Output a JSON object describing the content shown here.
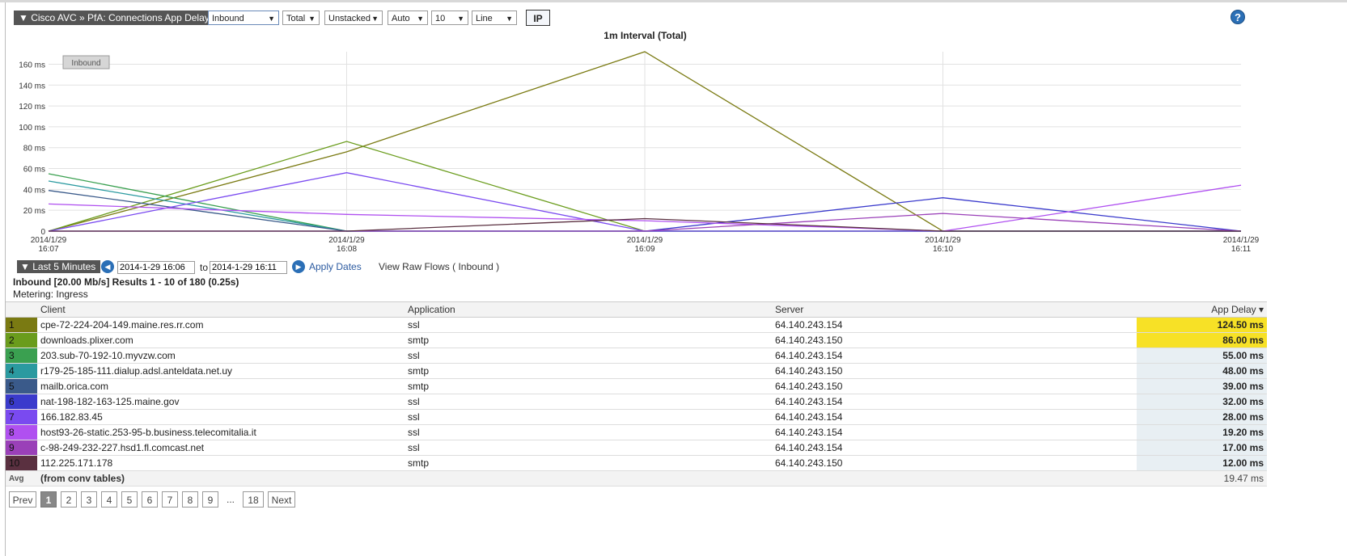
{
  "header": {
    "title": "▼ Cisco AVC » PfA: Connections App Delay",
    "selects": [
      "Inbound",
      "Total",
      "Unstacked",
      "Auto",
      "10",
      "Line"
    ],
    "ip_button": "IP",
    "help": "?"
  },
  "chart_data": {
    "type": "line",
    "title": "1m Interval (Total)",
    "legend_badge": "Inbound",
    "yticks": [
      "0",
      "20 ms",
      "40 ms",
      "60 ms",
      "80 ms",
      "100 ms",
      "120 ms",
      "140 ms",
      "160 ms"
    ],
    "ylim": [
      0,
      172
    ],
    "xticks": [
      [
        "2014/1/29",
        "16:07"
      ],
      [
        "2014/1/29",
        "16:08"
      ],
      [
        "2014/1/29",
        "16:09"
      ],
      [
        "2014/1/29",
        "16:10"
      ],
      [
        "2014/1/29",
        "16:11"
      ]
    ],
    "x_range_minutes": [
      0,
      4
    ],
    "series": [
      {
        "color": "#7a7a12",
        "points": [
          [
            0,
            0
          ],
          [
            1,
            76
          ],
          [
            2,
            172
          ],
          [
            3,
            0
          ],
          [
            4,
            0
          ]
        ]
      },
      {
        "color": "#6a9c1c",
        "points": [
          [
            0,
            0
          ],
          [
            1,
            86
          ],
          [
            2,
            0
          ],
          [
            3,
            0
          ],
          [
            4,
            0
          ]
        ]
      },
      {
        "color": "#3aa050",
        "points": [
          [
            0,
            55
          ],
          [
            1,
            0
          ],
          [
            2,
            0
          ],
          [
            3,
            0
          ],
          [
            4,
            0
          ]
        ]
      },
      {
        "color": "#2a9aa0",
        "points": [
          [
            0,
            48
          ],
          [
            1,
            0
          ],
          [
            2,
            0
          ],
          [
            3,
            0
          ],
          [
            4,
            0
          ]
        ]
      },
      {
        "color": "#3a5a8a",
        "points": [
          [
            0,
            39
          ],
          [
            1,
            0
          ],
          [
            2,
            0
          ],
          [
            3,
            0
          ],
          [
            4,
            0
          ]
        ]
      },
      {
        "color": "#3a3acc",
        "points": [
          [
            0,
            0
          ],
          [
            1,
            0
          ],
          [
            2,
            0
          ],
          [
            3,
            32
          ],
          [
            4,
            0
          ]
        ]
      },
      {
        "color": "#7a4af0",
        "points": [
          [
            0,
            0
          ],
          [
            1,
            56
          ],
          [
            2,
            0
          ],
          [
            3,
            0
          ],
          [
            4,
            0
          ]
        ]
      },
      {
        "color": "#b050f0",
        "points": [
          [
            0,
            26
          ],
          [
            1,
            16
          ],
          [
            2,
            10
          ],
          [
            3,
            0
          ],
          [
            4,
            44
          ]
        ]
      },
      {
        "color": "#9a40b8",
        "points": [
          [
            0,
            0
          ],
          [
            1,
            0
          ],
          [
            2,
            0
          ],
          [
            3,
            17
          ],
          [
            4,
            0
          ]
        ]
      },
      {
        "color": "#5a3040",
        "points": [
          [
            0,
            0
          ],
          [
            1,
            0
          ],
          [
            2,
            12
          ],
          [
            3,
            0
          ],
          [
            4,
            0
          ]
        ]
      }
    ]
  },
  "time_range": {
    "label": "▼ Last 5 Minutes",
    "prev_icon": "◀",
    "next_icon": "▶",
    "from": "2014-1-29 16:06",
    "to_label": "to",
    "to": "2014-1-29 16:11",
    "apply": "Apply Dates",
    "raw_flows": "View Raw Flows ( Inbound )"
  },
  "summary": "Inbound [20.00 Mb/s] Results 1 - 10 of 180 (0.25s)",
  "metering": "Metering: Ingress",
  "table": {
    "columns": [
      "Client",
      "Application",
      "Server",
      "App Delay ▾"
    ],
    "rows": [
      {
        "rank": "1",
        "color": "#7a7a12",
        "client": "cpe-72-224-204-149.maine.res.rr.com",
        "app": "ssl",
        "server": "64.140.243.154",
        "delay": "124.50 ms",
        "hot": true
      },
      {
        "rank": "2",
        "color": "#6a9c1c",
        "client": "downloads.plixer.com",
        "app": "smtp",
        "server": "64.140.243.150",
        "delay": "86.00 ms",
        "hot": true
      },
      {
        "rank": "3",
        "color": "#3aa050",
        "client": "203.sub-70-192-10.myvzw.com",
        "app": "ssl",
        "server": "64.140.243.154",
        "delay": "55.00 ms",
        "hot": false
      },
      {
        "rank": "4",
        "color": "#2a9aa0",
        "client": "r179-25-185-111.dialup.adsl.anteldata.net.uy",
        "app": "smtp",
        "server": "64.140.243.150",
        "delay": "48.00 ms",
        "hot": false
      },
      {
        "rank": "5",
        "color": "#3a5a8a",
        "client": "mailb.orica.com",
        "app": "smtp",
        "server": "64.140.243.150",
        "delay": "39.00 ms",
        "hot": false
      },
      {
        "rank": "6",
        "color": "#3a3acc",
        "client": "nat-198-182-163-125.maine.gov",
        "app": "ssl",
        "server": "64.140.243.154",
        "delay": "32.00 ms",
        "hot": false
      },
      {
        "rank": "7",
        "color": "#7a4af0",
        "client": "166.182.83.45",
        "app": "ssl",
        "server": "64.140.243.154",
        "delay": "28.00 ms",
        "hot": false
      },
      {
        "rank": "8",
        "color": "#b050f0",
        "client": "host93-26-static.253-95-b.business.telecomitalia.it",
        "app": "ssl",
        "server": "64.140.243.154",
        "delay": "19.20 ms",
        "hot": false
      },
      {
        "rank": "9",
        "color": "#9a40b8",
        "client": "c-98-249-232-227.hsd1.fl.comcast.net",
        "app": "ssl",
        "server": "64.140.243.154",
        "delay": "17.00 ms",
        "hot": false
      },
      {
        "rank": "10",
        "color": "#5a3040",
        "client": "112.225.171.178",
        "app": "smtp",
        "server": "64.140.243.150",
        "delay": "12.00 ms",
        "hot": false
      }
    ],
    "avg_label": "Avg",
    "avg_note": "(from conv tables)",
    "avg_value": "19.47 ms"
  },
  "pagination": {
    "prev": "Prev",
    "pages": [
      "1",
      "2",
      "3",
      "4",
      "5",
      "6",
      "7",
      "8",
      "9"
    ],
    "current": "1",
    "ellipsis": "...",
    "last": "18",
    "next": "Next"
  }
}
